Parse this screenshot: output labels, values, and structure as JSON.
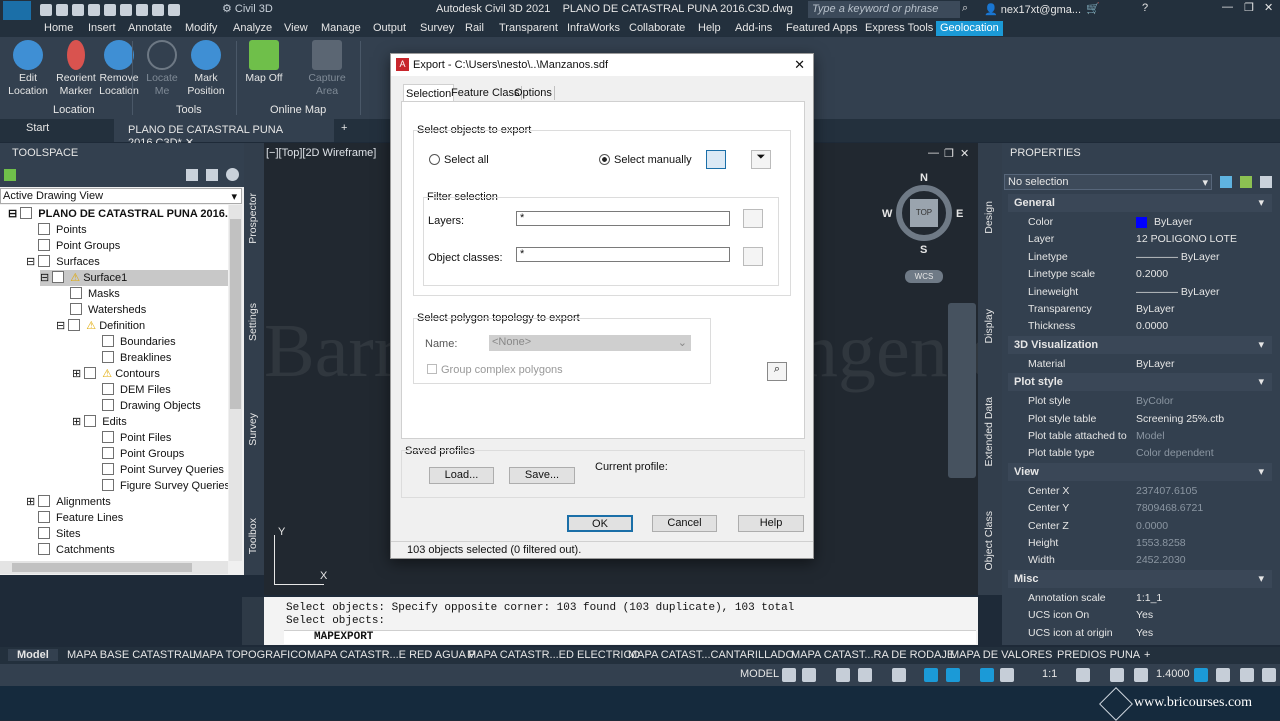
{
  "app": {
    "title": "Autodesk Civil 3D 2021",
    "file": "PLANO DE CATASTRAL PUNA 2016.C3D.dwg",
    "workspace": "Civil 3D",
    "search_placeholder": "Type a keyword or phrase",
    "user": "nex17xt@gma...",
    "logo": "C3D"
  },
  "ribbon_tabs": [
    "Home",
    "Insert",
    "Annotate",
    "Modify",
    "Analyze",
    "View",
    "Manage",
    "Output",
    "Survey",
    "Rail",
    "Transparent",
    "InfraWorks",
    "Collaborate",
    "Help",
    "Add-ins",
    "Featured Apps",
    "Express Tools",
    "Geolocation"
  ],
  "ribbon": {
    "edit_location": "Edit Location",
    "reorient_marker": "Reorient Marker",
    "remove_location": "Remove Location",
    "locate_me": "Locate Me",
    "mark_position": "Mark Position",
    "map_off": "Map Off",
    "capture_area": "Capture Area",
    "panel_location": "Location",
    "panel_tools": "Tools",
    "panel_online_map": "Online Map"
  },
  "file_tabs": {
    "start": "Start",
    "current": "PLANO DE CATASTRAL PUNA 2016.C3D*"
  },
  "toolspace": {
    "title": "TOOLSPACE",
    "view": "Active Drawing View",
    "root": "PLANO DE CATASTRAL PUNA 2016.C3D",
    "items": [
      "Points",
      "Point Groups",
      "Surfaces",
      "Surface1",
      "Masks",
      "Watersheds",
      "Definition",
      "Boundaries",
      "Breaklines",
      "Contours",
      "DEM Files",
      "Drawing Objects",
      "Edits",
      "Point Files",
      "Point Groups",
      "Point Survey Queries",
      "Figure Survey Queries",
      "Alignments",
      "Feature Lines",
      "Sites",
      "Catchments"
    ],
    "side_tabs": [
      "Prospector",
      "Settings",
      "Survey",
      "Toolbox"
    ]
  },
  "viewport": {
    "label": "[−][Top][2D Wireframe]",
    "compass": {
      "n": "N",
      "s": "S",
      "e": "E",
      "w": "W",
      "top": "TOP",
      "wcs": "WCS"
    },
    "watermark": "Barrera Romero Ingenieros",
    "axis_x": "X",
    "axis_y": "Y"
  },
  "dialog": {
    "title": "Export - C:\\Users\\nesto\\..\\Manzanos.sdf",
    "tabs": [
      "Selection",
      "Feature Class",
      "Options"
    ],
    "select_objects": "Select objects to export",
    "select_all": "Select all",
    "select_manually": "Select manually",
    "filter_selection": "Filter selection",
    "layers_label": "Layers:",
    "layers_value": "*",
    "classes_label": "Object classes:",
    "classes_value": "*",
    "topology": "Select polygon topology to export",
    "name_label": "Name:",
    "name_value": "<None>",
    "group_complex": "Group complex polygons",
    "saved_profiles": "Saved profiles",
    "load": "Load...",
    "save": "Save...",
    "current_profile": "Current profile:",
    "ok": "OK",
    "cancel": "Cancel",
    "help": "Help",
    "status": "103 objects selected (0 filtered out)."
  },
  "properties": {
    "title": "PROPERTIES",
    "selection": "No selection",
    "side_tabs": [
      "Design",
      "Display",
      "Extended Data",
      "Object Class"
    ],
    "sections": [
      {
        "name": "General",
        "rows": [
          [
            "Color",
            "ByLayer"
          ],
          [
            "Layer",
            "12 POLIGONO LOTE"
          ],
          [
            "Linetype",
            "———— ByLayer"
          ],
          [
            "Linetype scale",
            "0.2000"
          ],
          [
            "Lineweight",
            "———— ByLayer"
          ],
          [
            "Transparency",
            "ByLayer"
          ],
          [
            "Thickness",
            "0.0000"
          ]
        ]
      },
      {
        "name": "3D Visualization",
        "rows": [
          [
            "Material",
            "ByLayer"
          ]
        ]
      },
      {
        "name": "Plot style",
        "rows": [
          [
            "Plot style",
            "ByColor"
          ],
          [
            "Plot style table",
            "Screening 25%.ctb"
          ],
          [
            "Plot table attached to",
            "Model"
          ],
          [
            "Plot table type",
            "Color dependent"
          ]
        ]
      },
      {
        "name": "View",
        "rows": [
          [
            "Center X",
            "237407.6105"
          ],
          [
            "Center Y",
            "7809468.6721"
          ],
          [
            "Center Z",
            "0.0000"
          ],
          [
            "Height",
            "1553.8258"
          ],
          [
            "Width",
            "2452.2030"
          ]
        ]
      },
      {
        "name": "Misc",
        "rows": [
          [
            "Annotation scale",
            "1:1_1"
          ],
          [
            "UCS icon On",
            "Yes"
          ],
          [
            "UCS icon at origin",
            "Yes"
          ]
        ]
      }
    ]
  },
  "command": {
    "line1": "Select objects: Specify opposite corner: 103 found (103 duplicate), 103 total",
    "line2": "Select objects:",
    "input": "MAPEXPORT"
  },
  "layout_tabs": [
    "Model",
    "MAPA BASE CATASTRAL",
    "MAPA TOPOGRAFICO",
    "MAPA CATASTR...E RED AGUA P",
    "MAPA  CATASTR...ED ELECTRICO",
    "MAPA  CATAST...CANTARILLADO",
    "MAPA  CATAST...RA DE RODAJE",
    "MAPA  DE VALORES",
    "PREDIOS PUNA"
  ],
  "status": {
    "space": "MODEL",
    "scale": "1:1",
    "lineweight": "1.4000"
  },
  "brand": "www.bricourses.com",
  "colors": {
    "accent": "#1b9ad7",
    "bylayer_swatch": "#0000ff"
  }
}
